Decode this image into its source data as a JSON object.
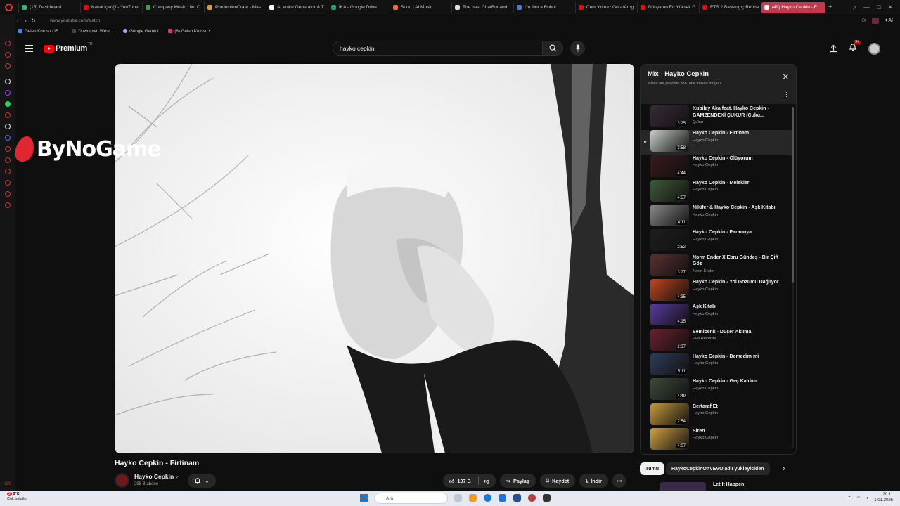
{
  "browser": {
    "tabs": [
      {
        "label": "(15) Dashboard",
        "color": "#25c16f"
      },
      {
        "label": "Kanal içeriği - YouTube",
        "color": "#ff0000"
      },
      {
        "label": "Company Music | No C",
        "color": "#3aa14a"
      },
      {
        "label": "ProductionCrate - Mas",
        "color": "#e39a2b"
      },
      {
        "label": "AI Voice Generator & T",
        "color": "#ffffff"
      },
      {
        "label": "İKA - Google Drive",
        "color": "#1fa463"
      },
      {
        "label": "Suno | AI Music",
        "color": "#ff6a2b"
      },
      {
        "label": "The best ChatBot and",
        "color": "#dddddd"
      },
      {
        "label": "I'm Not a Robot",
        "color": "#4a7bd8"
      },
      {
        "label": "Cem Yılmaz Gora/Arog",
        "color": "#ff0000"
      },
      {
        "label": "Dünyanın En Yüksek G",
        "color": "#ff0000"
      },
      {
        "label": "ETS 2 Başlangıç Rehbe",
        "color": "#ff0000"
      },
      {
        "label": "(49) Hayko Cepkin - F",
        "color": "#ffffff",
        "active": true
      }
    ],
    "url": "www.youtube.com/watch",
    "bookmarks": [
      "Gelen Kutusu (15...",
      "Downtown West...",
      "Google Gemini",
      "(8) Gelen Kutusu •..."
    ],
    "ai_label": "AI"
  },
  "youtube": {
    "logo_text": "Premium",
    "logo_region": "TR",
    "search_value": "hayko cepkin",
    "notification_count": "9+"
  },
  "video": {
    "overlay_watermark": "ByNoGame",
    "title": "Hayko Cepkin - Firtinam",
    "channel": "Hayko Cepkin",
    "subscribers": "298 B abone",
    "likes": "107 B",
    "share_label": "Paylaş",
    "save_label": "Kaydet",
    "download_label": "İndir"
  },
  "mix": {
    "title": "Mix - Hayko Cepkin",
    "subtitle": "Mixes are playlists YouTube makes for you",
    "items": [
      {
        "title": "Kubilay Aka feat. Hayko Cepkin - GAMZENDEKİ ÇUKUR (Çuku...",
        "channel": "Çukur",
        "duration": "3:25",
        "color": "#3a2a3a"
      },
      {
        "title": "Hayko Cepkin - Firtinam",
        "channel": "Hayko Cepkin",
        "duration": "3:58",
        "color": "#c9cfc9",
        "current": true
      },
      {
        "title": "Hayko Cepkin - Ölüyorum",
        "channel": "Hayko Cepkin",
        "duration": "4:44",
        "color": "#3b1a1a"
      },
      {
        "title": "Hayko Cepkin - Melekler",
        "channel": "Hayko Cepkin",
        "duration": "4:57",
        "color": "#3f5a3a"
      },
      {
        "title": "Nilüfer & Hayko Cepkin - Aşk Kitabı",
        "channel": "Hayko Cepkin",
        "duration": "4:11",
        "color": "#8a8a8a"
      },
      {
        "title": "Hayko Cepkin - Paranoya",
        "channel": "Hayko Cepkin",
        "duration": "2:52",
        "color": "#1e1e1e"
      },
      {
        "title": "Norm Ender X Ebru Gündeş - Bir Çift Göz",
        "channel": "Norm Ender",
        "duration": "3:27",
        "color": "#5a3030"
      },
      {
        "title": "Hayko Cepkin - Yol Gözümü Dağlıyor",
        "channel": "Hayko Cepkin",
        "duration": "4:35",
        "color": "#c0461f"
      },
      {
        "title": "Aşk Kitabı",
        "channel": "Hayko Cepkin",
        "duration": "4:15",
        "color": "#5a3aa0"
      },
      {
        "title": "Semicenk - Düşer Aklıma",
        "channel": "Eva Records",
        "duration": "2:37",
        "color": "#6a2030"
      },
      {
        "title": "Hayko Cepkin - Demedim mi",
        "channel": "Hayko Cepkin",
        "duration": "5:11",
        "color": "#2e3c5a"
      },
      {
        "title": "Hayko Cepkin - Geç Kaldım",
        "channel": "Hayko Cepkin",
        "duration": "4:49",
        "color": "#3c4a3c"
      },
      {
        "title": "Bertaraf Et",
        "channel": "Hayko Cepkin",
        "duration": "2:54",
        "color": "#c79a3a"
      },
      {
        "title": "Siren",
        "channel": "Hayko Cepkin",
        "duration": "4:07",
        "color": "#d2a040"
      }
    ]
  },
  "chips": {
    "all": "Tümü",
    "uploader": "HaykoCepkinOnVEVO adlı yükleyiciden"
  },
  "next_item_title": "Let It Happen",
  "taskbar": {
    "temp": "0°C",
    "weather": "Çok bulutlu",
    "weather_badge": "2",
    "search_placeholder": "Ara",
    "time": "20:11",
    "date": "1.01.2026"
  }
}
